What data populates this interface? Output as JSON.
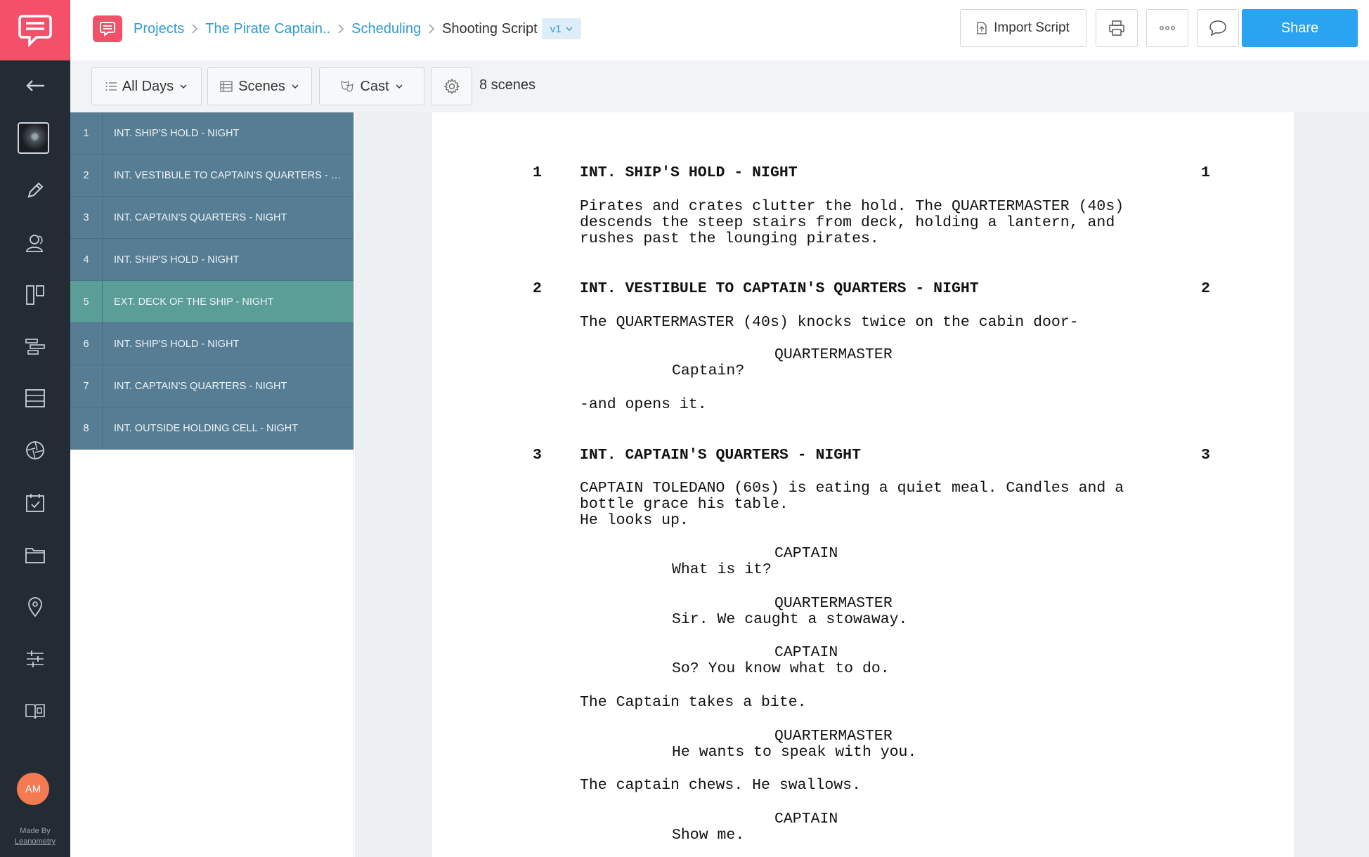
{
  "rail": {
    "made_by_label": "Made By",
    "made_by_brand": "Leanometry",
    "user_initials": "AM",
    "icons": [
      "back-arrow-icon",
      "storyboard-thumbnail",
      "pencil-icon",
      "characters-icon",
      "layout-icon",
      "timeline-icon",
      "list-icon",
      "shot-aperture-icon",
      "calendar-icon",
      "folder-icon",
      "location-pin-icon",
      "sliders-icon",
      "book-icon"
    ]
  },
  "header": {
    "breadcrumb": [
      "Projects",
      "The Pirate Captain..",
      "Scheduling",
      "Shooting Script"
    ],
    "version": "v1",
    "import_label": "Import Script",
    "share_label": "Share"
  },
  "filters": {
    "days_label": "All Days",
    "scenes_label": "Scenes",
    "cast_label": "Cast",
    "scene_count": "8 scenes"
  },
  "scenes": [
    {
      "num": "1",
      "title": "INT. SHIP'S HOLD - NIGHT"
    },
    {
      "num": "2",
      "title": "INT. VESTIBULE TO CAPTAIN'S QUARTERS - NIGHT"
    },
    {
      "num": "3",
      "title": "INT. CAPTAIN'S QUARTERS - NIGHT"
    },
    {
      "num": "4",
      "title": "INT. SHIP'S HOLD - NIGHT"
    },
    {
      "num": "5",
      "title": "EXT. DECK OF THE SHIP - NIGHT"
    },
    {
      "num": "6",
      "title": "INT. SHIP'S HOLD - NIGHT"
    },
    {
      "num": "7",
      "title": "INT. CAPTAIN'S QUARTERS - NIGHT"
    },
    {
      "num": "8",
      "title": "INT. OUTSIDE HOLDING CELL - NIGHT"
    }
  ],
  "active_scene": "5",
  "script": {
    "s1_num": "1",
    "s1_heading": "INT. SHIP'S HOLD - NIGHT",
    "s1_action": [
      "Pirates and crates clutter the hold. The QUARTERMASTER (40s)",
      "descends the steep stairs from deck, holding a lantern, and",
      "rushes past the lounging pirates."
    ],
    "s2_num": "2",
    "s2_heading": "INT. VESTIBULE TO CAPTAIN'S QUARTERS - NIGHT",
    "s2_action1": "The QUARTERMASTER (40s) knocks twice on the cabin door-",
    "s2_char1": "QUARTERMASTER",
    "s2_dial1": "Captain?",
    "s2_action2": "-and opens it.",
    "s3_num": "3",
    "s3_heading": "INT. CAPTAIN'S QUARTERS - NIGHT",
    "s3_action1": [
      "CAPTAIN TOLEDANO (60s) is eating a quiet meal. Candles and a",
      "bottle grace his table.",
      "He looks up."
    ],
    "s3_char1": "CAPTAIN",
    "s3_dial1": "What is it?",
    "s3_char2": "QUARTERMASTER",
    "s3_dial2": "Sir. We caught a stowaway.",
    "s3_char3": "CAPTAIN",
    "s3_dial3": "So? You know what to do.",
    "s3_action2": "The Captain takes a bite.",
    "s3_char4": "QUARTERMASTER",
    "s3_dial4": "He wants to speak with you.",
    "s3_action3": "The captain chews. He swallows.",
    "s3_char5": "CAPTAIN",
    "s3_dial5": "Show me."
  },
  "colors": {
    "brand": "#f4506a",
    "link": "#2f9ad6",
    "share": "#2aa3f0",
    "scene_row": "#567d93",
    "scene_row_active": "#5b9e98"
  }
}
